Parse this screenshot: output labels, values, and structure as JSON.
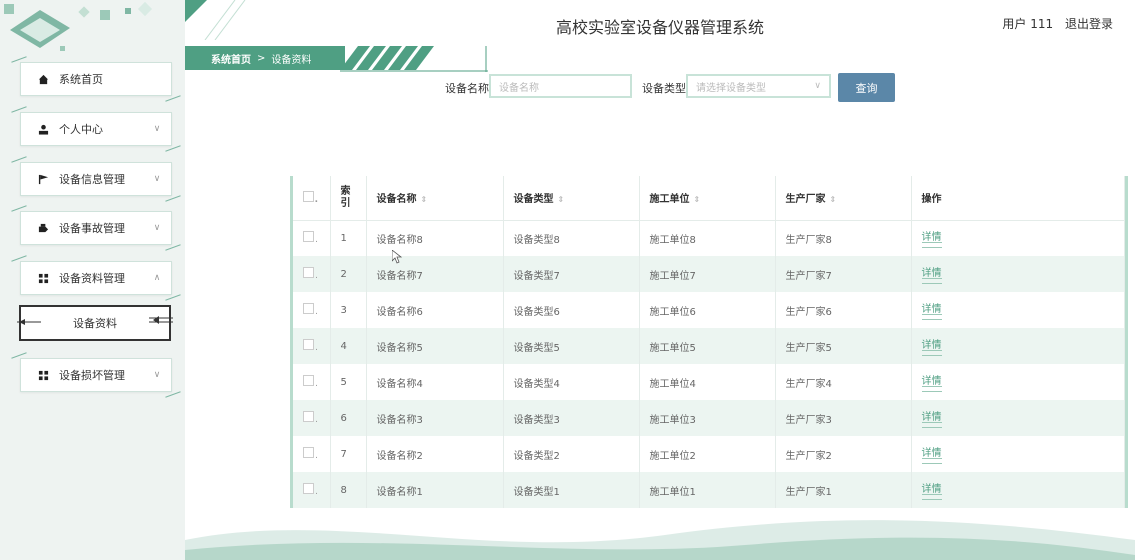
{
  "header": {
    "title": "高校实验室设备仪器管理系统",
    "user": "用户 111",
    "logout": "退出登录"
  },
  "sidebar": {
    "items": [
      {
        "label": "系统首页",
        "icon": "home-icon"
      },
      {
        "label": "个人中心",
        "icon": "user-icon"
      },
      {
        "label": "设备信息管理",
        "icon": "flag-icon"
      },
      {
        "label": "设备事故管理",
        "icon": "tag-icon"
      },
      {
        "label": "设备资料管理",
        "icon": "grid-icon"
      },
      {
        "label": "设备损坏管理",
        "icon": "grid-icon"
      }
    ],
    "sub_item": "设备资料"
  },
  "breadcrumb": {
    "home": "系统首页",
    "sep": ">",
    "current": "设备资料"
  },
  "search": {
    "name_label": "设备名称",
    "name_placeholder": "设备名称",
    "type_label": "设备类型",
    "type_placeholder": "请选择设备类型",
    "button": "查询"
  },
  "table": {
    "headers": {
      "index": "索引",
      "name": "设备名称",
      "type": "设备类型",
      "unit": "施工单位",
      "maker": "生产厂家",
      "ops": "操作"
    },
    "rows": [
      {
        "idx": "1",
        "name": "设备名称8",
        "type": "设备类型8",
        "unit": "施工单位8",
        "maker": "生产厂家8",
        "op": "详情"
      },
      {
        "idx": "2",
        "name": "设备名称7",
        "type": "设备类型7",
        "unit": "施工单位7",
        "maker": "生产厂家7",
        "op": "详情"
      },
      {
        "idx": "3",
        "name": "设备名称6",
        "type": "设备类型6",
        "unit": "施工单位6",
        "maker": "生产厂家6",
        "op": "详情"
      },
      {
        "idx": "4",
        "name": "设备名称5",
        "type": "设备类型5",
        "unit": "施工单位5",
        "maker": "生产厂家5",
        "op": "详情"
      },
      {
        "idx": "5",
        "name": "设备名称4",
        "type": "设备类型4",
        "unit": "施工单位4",
        "maker": "生产厂家4",
        "op": "详情"
      },
      {
        "idx": "6",
        "name": "设备名称3",
        "type": "设备类型3",
        "unit": "施工单位3",
        "maker": "生产厂家3",
        "op": "详情"
      },
      {
        "idx": "7",
        "name": "设备名称2",
        "type": "设备类型2",
        "unit": "施工单位2",
        "maker": "生产厂家2",
        "op": "详情"
      },
      {
        "idx": "8",
        "name": "设备名称1",
        "type": "设备类型1",
        "unit": "施工单位1",
        "maker": "生产厂家1",
        "op": "详情"
      }
    ]
  },
  "colors": {
    "accent": "#4f9f83",
    "button": "#5b87a8",
    "row_alt": "#ecf5f1"
  }
}
